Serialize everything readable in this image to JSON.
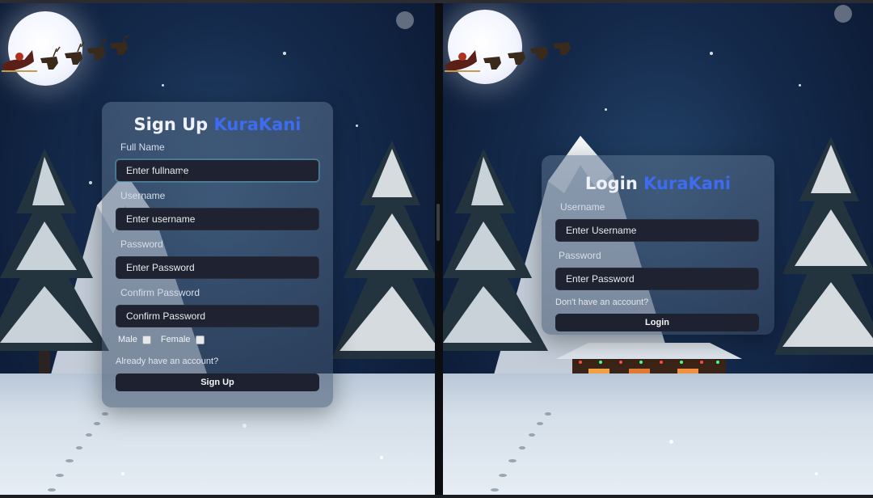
{
  "signup": {
    "title_prefix": "Sign Up",
    "title_brand": "KuraKani",
    "fullname_label": "Full Name",
    "fullname_placeholder": "Enter fullname",
    "username_label": "Username",
    "username_placeholder": "Enter username",
    "password_label": "Password",
    "password_placeholder": "Enter Password",
    "confirm_label": "Confirm Password",
    "confirm_placeholder": "Confirm Password",
    "gender_male": "Male",
    "gender_female": "Female",
    "login_link": "Already have an account?",
    "submit_label": "Sign Up"
  },
  "login": {
    "title_prefix": "Login",
    "title_brand": "KuraKani",
    "username_label": "Username",
    "username_placeholder": "Enter Username",
    "password_label": "Password",
    "password_placeholder": "Enter Password",
    "signup_link": "Don't have an account?",
    "submit_label": "Login"
  },
  "colors": {
    "brand": "#3d6cf0",
    "input_bg": "#1f2230",
    "night_sky": "#14294a"
  }
}
